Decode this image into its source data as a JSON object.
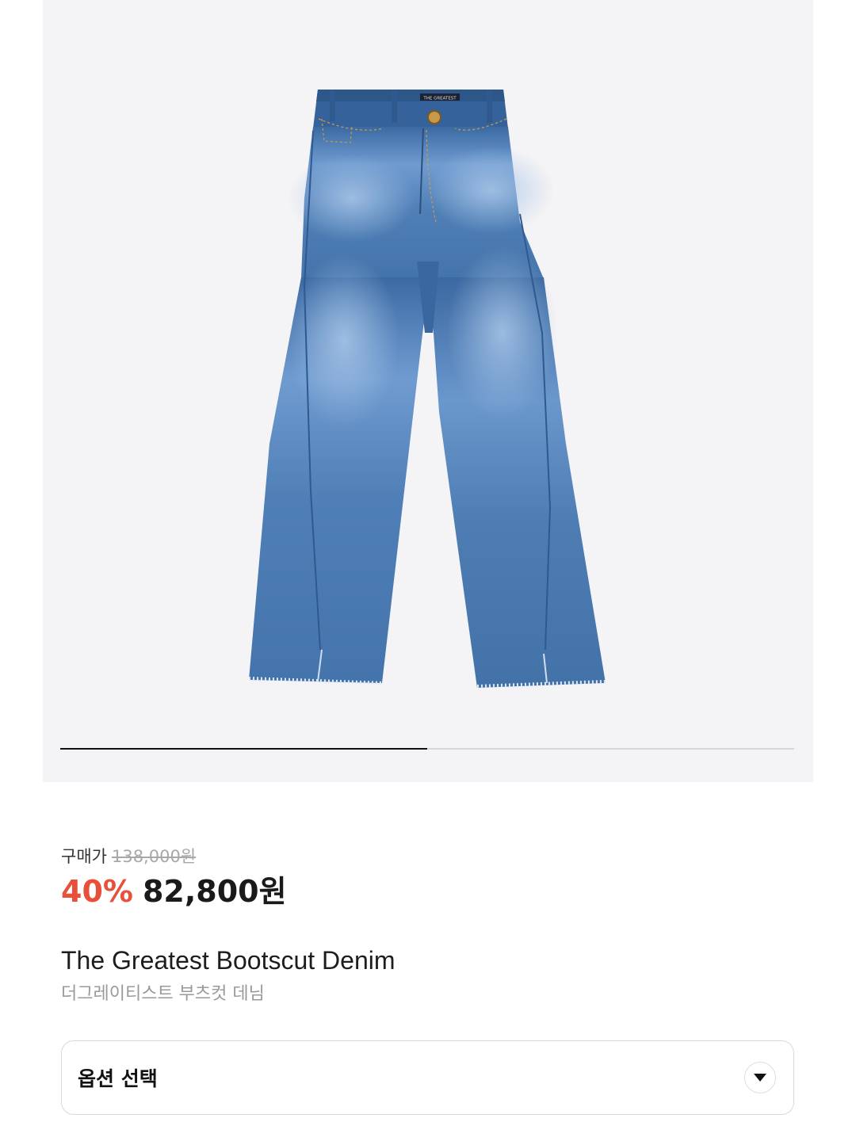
{
  "gallery": {
    "image_alt": "Blue bootcut denim jeans with raw frayed hems",
    "brand_tag": "THE GREATEST",
    "current_slide": 1,
    "total_slides": 2,
    "progress_fraction": 0.5,
    "colors": {
      "background": "#f4f3f5",
      "denim": "#4f7fb4",
      "denim_dark": "#2f5a8f",
      "progress_active": "#111111",
      "progress_track": "#d7d7da"
    }
  },
  "price": {
    "label": "구매가",
    "original": "138,000원",
    "discount": "40%",
    "sale": "82,800원",
    "discount_color": "#e8503a"
  },
  "product": {
    "name_en": "The Greatest Bootscut Denim",
    "name_ko": "더그레이티스트 부츠컷 데님"
  },
  "option": {
    "label": "옵션 선택",
    "icon": "chevron-down-icon"
  }
}
